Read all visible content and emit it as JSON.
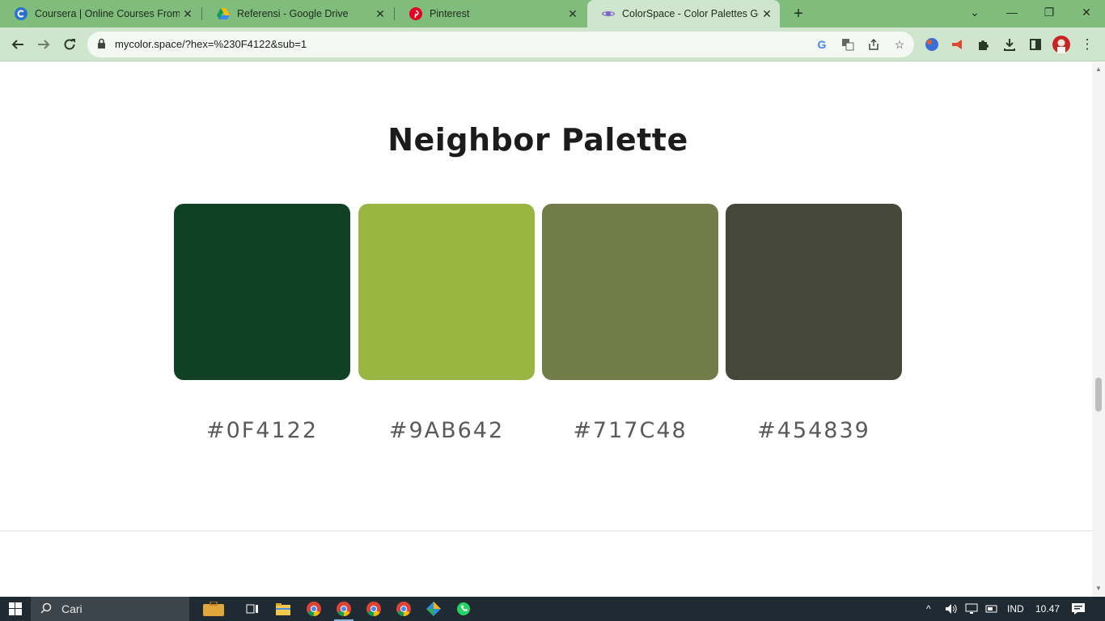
{
  "browser": {
    "tabs": [
      {
        "title": "Coursera | Online Courses From",
        "icon": "coursera-icon",
        "active": false
      },
      {
        "title": "Referensi - Google Drive",
        "icon": "google-drive-icon",
        "active": false
      },
      {
        "title": "Pinterest",
        "icon": "pinterest-icon",
        "active": false
      },
      {
        "title": "ColorSpace - Color Palettes Gen",
        "icon": "colorspace-icon",
        "active": true
      }
    ],
    "url": "mycolor.space/?hex=%230F4122&sub=1"
  },
  "page": {
    "heading": "Neighbor Palette",
    "palette": [
      {
        "hex": "#0F4122",
        "color": "#0F4122"
      },
      {
        "hex": "#9AB642",
        "color": "#9AB642"
      },
      {
        "hex": "#717C48",
        "color": "#717C48"
      },
      {
        "hex": "#454839",
        "color": "#454839"
      }
    ]
  },
  "taskbar": {
    "search_placeholder": "Cari",
    "language": "IND",
    "time": "10.47"
  },
  "colors": {
    "tabbar_bg": "#80bd7c",
    "toolbar_bg": "#cfe5cd",
    "taskbar_bg": "#1f2a32"
  }
}
